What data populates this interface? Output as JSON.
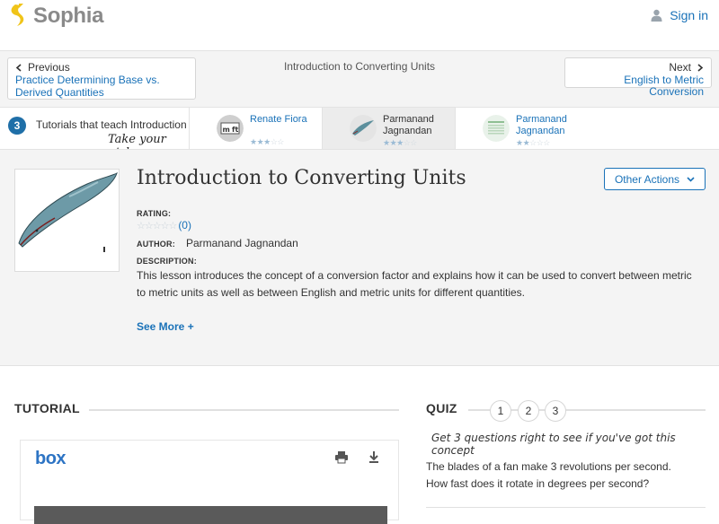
{
  "header": {
    "logo_text": "Sophia",
    "signin_label": "Sign in",
    "brand_color": "#f0c419",
    "link_color": "#1a72b8"
  },
  "nav": {
    "prev_label": "Previous",
    "prev_title_line1": "Practice Determining Base vs.",
    "prev_title_line2": "Derived Quantities",
    "center_title": "Introduction to Converting Units",
    "next_label": "Next",
    "next_title": "English to Metric Conversion"
  },
  "tutorials": {
    "count": "3",
    "heading": "Tutorials that teach Introduction",
    "take_pick": "Take your pick:",
    "cards": [
      {
        "author_line1": "Renate Fiora",
        "author_line2": "",
        "stars": 3,
        "icon": "measuring-units-icon"
      },
      {
        "author_line1": "Parmanand",
        "author_line2": "Jagnandan",
        "stars": 3,
        "icon": "whale-icon"
      },
      {
        "author_line1": "Parmanand",
        "author_line2": "Jagnandan",
        "stars": 2,
        "icon": "table-thumbnail-icon"
      }
    ]
  },
  "lesson": {
    "title": "Introduction to Converting Units",
    "other_actions": "Other Actions",
    "rating_label": "RATING:",
    "rating_count": "(0)",
    "author_label": "AUTHOR:",
    "author_name": "Parmanand Jagnandan",
    "description_label": "DESCRIPTION:",
    "description": "This lesson introduces the concept of a conversion factor and explains how it can be used to convert between metric to metric units as well as between English and metric units for different quantities.",
    "see_more": "See More +"
  },
  "tutorial_section": {
    "heading": "TUTORIAL",
    "box_logo": "box"
  },
  "quiz": {
    "heading": "QUIZ",
    "numbers": [
      "1",
      "2",
      "3"
    ],
    "tagline": "Get 3 questions right to see if you've got this concept",
    "question": "The blades of a fan make 3 revolutions per second. How fast does it rotate in degrees per second?"
  }
}
